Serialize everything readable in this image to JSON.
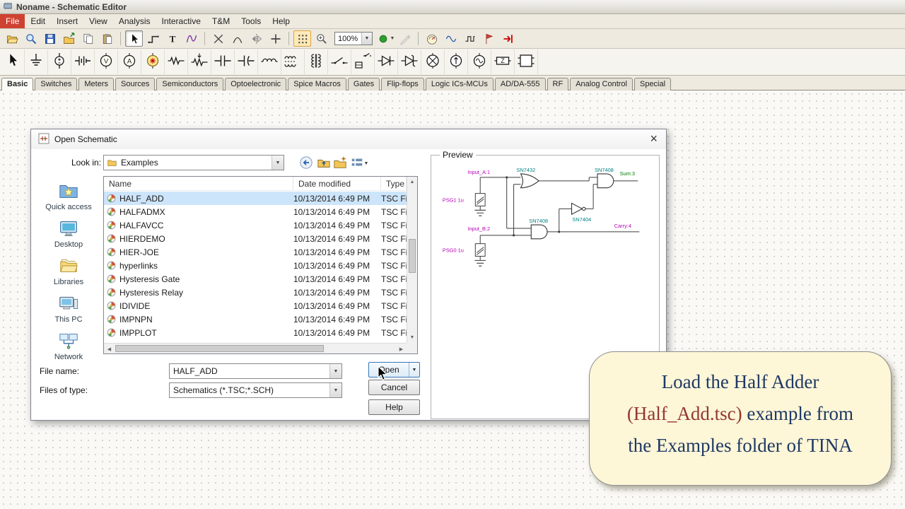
{
  "window": {
    "title": "Noname - Schematic Editor"
  },
  "menubar": {
    "items": [
      {
        "label": "File",
        "highlight": true
      },
      {
        "label": "Edit"
      },
      {
        "label": "Insert"
      },
      {
        "label": "View"
      },
      {
        "label": "Analysis"
      },
      {
        "label": "Interactive"
      },
      {
        "label": "T&M"
      },
      {
        "label": "Tools"
      },
      {
        "label": "Help"
      }
    ]
  },
  "toolbar_main": {
    "zoom_value": "100%",
    "group_a": [
      {
        "name": "open",
        "icon": "open"
      },
      {
        "name": "preview-zoom",
        "icon": "preview"
      },
      {
        "name": "save",
        "icon": "save"
      },
      {
        "name": "export",
        "icon": "export"
      },
      {
        "name": "copy",
        "icon": "copy"
      },
      {
        "name": "paste",
        "icon": "paste"
      },
      {
        "sep": true
      },
      {
        "name": "select-cursor",
        "icon": "cursor",
        "pressed": true
      },
      {
        "name": "wire-tool",
        "icon": "wire"
      },
      {
        "name": "text-tool",
        "icon": "text"
      },
      {
        "name": "waveform-tool",
        "icon": "waveform"
      },
      {
        "sep": true
      },
      {
        "name": "delete-tool",
        "icon": "cross"
      },
      {
        "name": "arc-tool",
        "icon": "arc"
      },
      {
        "name": "mirror-tool",
        "icon": "mirror"
      },
      {
        "name": "node-tool",
        "icon": "plus"
      },
      {
        "sep": true
      },
      {
        "name": "grid-toggle",
        "icon": "grid",
        "active": true
      },
      {
        "name": "zoom-in",
        "icon": "zoomin"
      }
    ],
    "group_b": [
      {
        "name": "color-picker",
        "icon": "color",
        "caret": true
      },
      {
        "name": "pen-tool",
        "icon": "pen",
        "disabled": true
      },
      {
        "sep": true
      },
      {
        "name": "dc-analysis",
        "icon": "meter"
      },
      {
        "name": "ac-analysis",
        "icon": "sine"
      },
      {
        "name": "transient-analysis",
        "icon": "square"
      },
      {
        "name": "analysis-flag",
        "icon": "flag"
      },
      {
        "name": "run-interactive",
        "icon": "redarrow"
      }
    ]
  },
  "component_toolbar": {
    "items": [
      {
        "name": "select",
        "icon": "select"
      },
      {
        "name": "ground",
        "icon": "ground"
      },
      {
        "name": "voltage-source",
        "icon": "vsource"
      },
      {
        "name": "battery",
        "icon": "battery"
      },
      {
        "name": "voltmeter",
        "icon": "voltmeter"
      },
      {
        "name": "ammeter",
        "icon": "ammeter"
      },
      {
        "name": "generator",
        "icon": "generator"
      },
      {
        "name": "resistor",
        "icon": "resistor"
      },
      {
        "name": "potentiometer",
        "icon": "potentiometer"
      },
      {
        "name": "capacitor",
        "icon": "capacitor"
      },
      {
        "name": "electrolytic-capacitor",
        "icon": "ecap"
      },
      {
        "name": "inductor",
        "icon": "inductor"
      },
      {
        "name": "coupled-inductor",
        "icon": "coupled"
      },
      {
        "name": "transformer",
        "icon": "transformer"
      },
      {
        "name": "switch",
        "icon": "switch"
      },
      {
        "name": "relay",
        "icon": "relay"
      },
      {
        "name": "diode",
        "icon": "diode"
      },
      {
        "name": "zener-diode",
        "icon": "zener"
      },
      {
        "name": "lamp",
        "icon": "lamp"
      },
      {
        "name": "current-source",
        "icon": "isource"
      },
      {
        "name": "ac-source",
        "icon": "acsource"
      },
      {
        "name": "impedance",
        "icon": "impedance"
      },
      {
        "name": "macro",
        "icon": "macro"
      }
    ]
  },
  "tabbar": {
    "tabs": [
      {
        "label": "Basic",
        "active": true
      },
      {
        "label": "Switches"
      },
      {
        "label": "Meters"
      },
      {
        "label": "Sources"
      },
      {
        "label": "Semiconductors"
      },
      {
        "label": "Optoelectronic"
      },
      {
        "label": "Spice Macros"
      },
      {
        "label": "Gates"
      },
      {
        "label": "Flip-flops"
      },
      {
        "label": "Logic ICs-MCUs"
      },
      {
        "label": "AD/DA-555"
      },
      {
        "label": "RF"
      },
      {
        "label": "Analog Control"
      },
      {
        "label": "Special"
      }
    ]
  },
  "dialog": {
    "title": "Open Schematic",
    "look_in_label": "Look in:",
    "look_in_value": "Examples",
    "sidebar": [
      {
        "name": "quick-access",
        "label": "Quick access",
        "icon": "quick"
      },
      {
        "name": "desktop",
        "label": "Desktop",
        "icon": "desktop"
      },
      {
        "name": "libraries",
        "label": "Libraries",
        "icon": "libraries"
      },
      {
        "name": "this-pc",
        "label": "This PC",
        "icon": "thispc"
      },
      {
        "name": "network",
        "label": "Network",
        "icon": "network"
      }
    ],
    "columns": [
      "Name",
      "Date modified",
      "Type"
    ],
    "files": [
      {
        "name": "HALF_ADD",
        "date": "10/13/2014 6:49 PM",
        "type": "TSC Fi",
        "selected": true
      },
      {
        "name": "HALFADMX",
        "date": "10/13/2014 6:49 PM",
        "type": "TSC Fi",
        "selected": false
      },
      {
        "name": "HALFAVCC",
        "date": "10/13/2014 6:49 PM",
        "type": "TSC Fi",
        "selected": false
      },
      {
        "name": "HIERDEMO",
        "date": "10/13/2014 6:49 PM",
        "type": "TSC Fi",
        "selected": false
      },
      {
        "name": "HIER-JOE",
        "date": "10/13/2014 6:49 PM",
        "type": "TSC Fi",
        "selected": false
      },
      {
        "name": "hyperlinks",
        "date": "10/13/2014 6:49 PM",
        "type": "TSC Fi",
        "selected": false
      },
      {
        "name": "Hysteresis Gate",
        "date": "10/13/2014 6:49 PM",
        "type": "TSC Fi",
        "selected": false
      },
      {
        "name": "Hysteresis Relay",
        "date": "10/13/2014 6:49 PM",
        "type": "TSC Fi",
        "selected": false
      },
      {
        "name": "IDIVIDE",
        "date": "10/13/2014 6:49 PM",
        "type": "TSC Fi",
        "selected": false
      },
      {
        "name": "IMPNPN",
        "date": "10/13/2014 6:49 PM",
        "type": "TSC Fi",
        "selected": false
      },
      {
        "name": "IMPPLOT",
        "date": "10/13/2014 6:49 PM",
        "type": "TSC Fi",
        "selected": false
      }
    ],
    "file_name_label": "File name:",
    "file_name_value": "HALF_ADD",
    "files_of_type_label": "Files of type:",
    "files_of_type_value": "Schematics (*.TSC;*.SCH)",
    "open_button": "Open",
    "cancel_button": "Cancel",
    "help_button": "Help",
    "preview": {
      "label": "Preview",
      "parts": {
        "input_a": "Input_A:1",
        "input_b": "Input_B:2",
        "psg1": "PSG1 1u",
        "psg0": "PSG0 1u",
        "or1": "SN7432",
        "and1": "SN7408",
        "not1": "SN7404",
        "and2": "SN7408",
        "sum": "Sum:3",
        "carry": "Carry:4"
      }
    }
  },
  "callout": {
    "line1": "Load the Half Adder",
    "red_text": "(Half_Add.tsc)",
    "line2_rest": " example from",
    "line3": "the Examples folder of TINA"
  },
  "colors": {
    "selection": "#cde5fa",
    "menu_highlight": "#cf4232",
    "callout_bg": "#fdf6d7",
    "callout_text": "#1f3864",
    "callout_red": "#943634"
  }
}
